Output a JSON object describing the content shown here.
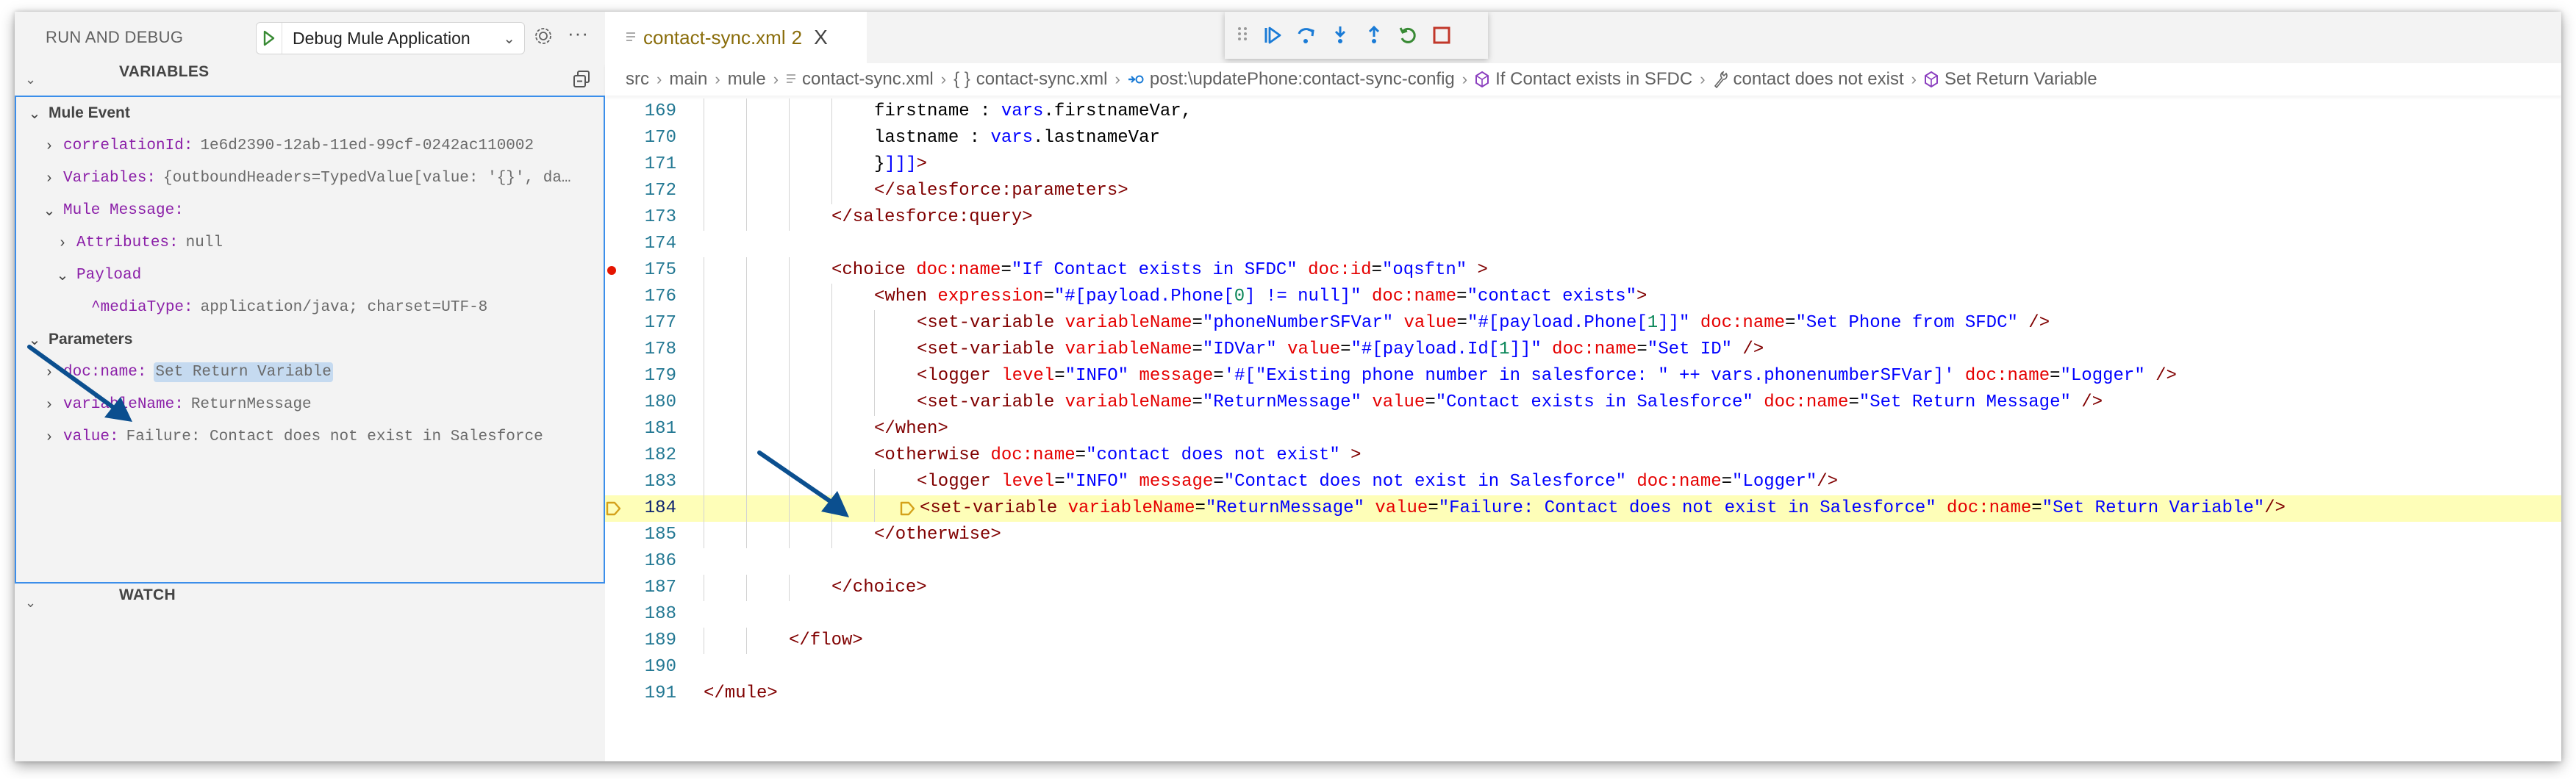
{
  "sidebar": {
    "title": "RUN AND DEBUG",
    "launch_config": "Debug Mule Application",
    "more_label": "···",
    "variables_header": "VARIABLES",
    "watch_header": "WATCH",
    "tree": [
      {
        "type": "group",
        "label": "Mule Event",
        "expanded": true
      },
      {
        "type": "item",
        "key": "correlationId:",
        "value": "1e6d2390-12ab-11ed-99cf-0242ac110002",
        "expanded": false
      },
      {
        "type": "item",
        "key": "Variables:",
        "value": "{outboundHeaders=TypedValue[value: '{}', da…",
        "expanded": false
      },
      {
        "type": "item",
        "key": "Mule Message:",
        "value": "",
        "expanded": true
      },
      {
        "type": "item",
        "key": "Attributes:",
        "value": "null",
        "expanded": false
      },
      {
        "type": "item",
        "key": "Payload",
        "value": "",
        "expanded": true
      },
      {
        "type": "leaf",
        "key": "^mediaType:",
        "value": "application/java; charset=UTF-8"
      },
      {
        "type": "group",
        "label": "Parameters",
        "expanded": true
      },
      {
        "type": "item",
        "key": "doc:name:",
        "value": "Set Return Variable",
        "expanded": false,
        "selected": true
      },
      {
        "type": "item",
        "key": "variableName:",
        "value": "ReturnMessage",
        "expanded": false
      },
      {
        "type": "item",
        "key": "value:",
        "value": "Failure: Contact does not exist in Salesforce",
        "expanded": false
      }
    ]
  },
  "editor": {
    "tab": {
      "name": "contact-sync.xml",
      "problems": "2",
      "close": "X"
    },
    "debug_toolbar": [
      "drag-handle",
      "continue",
      "step-over",
      "step-into",
      "step-out",
      "restart",
      "stop"
    ],
    "breadcrumb": [
      {
        "label": "src",
        "icon": ""
      },
      {
        "label": "main",
        "icon": ""
      },
      {
        "label": "mule",
        "icon": ""
      },
      {
        "label": "contact-sync.xml",
        "icon": "xml-file-icon"
      },
      {
        "label": "contact-sync.xml",
        "icon": "braces-icon"
      },
      {
        "label": "post:\\updatePhone:contact-sync-config",
        "icon": "flow-icon"
      },
      {
        "label": "If Contact exists in SFDC",
        "icon": "component-icon"
      },
      {
        "label": "contact does not exist",
        "icon": "wrench-icon"
      },
      {
        "label": "Set Return Variable",
        "icon": "component-icon"
      }
    ],
    "breakpoint_line": 175,
    "current_line": 184,
    "lines": [
      {
        "n": "169",
        "indent": 4,
        "tokens": [
          [
            "p",
            "firstname : "
          ],
          [
            "e",
            "vars"
          ],
          [
            "p",
            ".firstnameVar,"
          ]
        ]
      },
      {
        "n": "170",
        "indent": 4,
        "tokens": [
          [
            "p",
            "lastname : "
          ],
          [
            "e",
            "vars"
          ],
          [
            "p",
            ".lastnameVar"
          ]
        ]
      },
      {
        "n": "171",
        "indent": 4,
        "tokens": [
          [
            "p",
            "}"
          ],
          [
            "s",
            "]]]"
          ],
          [
            "t",
            ">"
          ]
        ]
      },
      {
        "n": "172",
        "indent": 4,
        "tokens": [
          [
            "t",
            "</salesforce:parameters>"
          ]
        ]
      },
      {
        "n": "173",
        "indent": 3,
        "tokens": [
          [
            "t",
            "</salesforce:query>"
          ]
        ]
      },
      {
        "n": "174",
        "indent": 0,
        "tokens": []
      },
      {
        "n": "175",
        "indent": 3,
        "tokens": [
          [
            "t",
            "<choice "
          ],
          [
            "a",
            "doc:name"
          ],
          [
            "p",
            "="
          ],
          [
            "s",
            "\"If Contact exists in SFDC\" "
          ],
          [
            "a",
            "doc:id"
          ],
          [
            "p",
            "="
          ],
          [
            "s",
            "\"oqsftn\""
          ],
          [
            "t",
            " >"
          ]
        ]
      },
      {
        "n": "176",
        "indent": 4,
        "tokens": [
          [
            "t",
            "<when "
          ],
          [
            "a",
            "expression"
          ],
          [
            "p",
            "="
          ],
          [
            "s",
            "\"#[payload.Phone["
          ],
          [
            "n",
            "0"
          ],
          [
            "s",
            "] != null]\" "
          ],
          [
            "a",
            "doc:name"
          ],
          [
            "p",
            "="
          ],
          [
            "s",
            "\"contact exists\""
          ],
          [
            "t",
            ">"
          ]
        ]
      },
      {
        "n": "177",
        "indent": 5,
        "tokens": [
          [
            "t",
            "<set-variable "
          ],
          [
            "a",
            "variableName"
          ],
          [
            "p",
            "="
          ],
          [
            "s",
            "\"phoneNumberSFVar\" "
          ],
          [
            "a",
            "value"
          ],
          [
            "p",
            "="
          ],
          [
            "s",
            "\"#[payload.Phone["
          ],
          [
            "n",
            "1"
          ],
          [
            "s",
            "]]\" "
          ],
          [
            "a",
            "doc:name"
          ],
          [
            "p",
            "="
          ],
          [
            "s",
            "\"Set Phone from SFDC\""
          ],
          [
            "t",
            " />"
          ]
        ]
      },
      {
        "n": "178",
        "indent": 5,
        "tokens": [
          [
            "t",
            "<set-variable "
          ],
          [
            "a",
            "variableName"
          ],
          [
            "p",
            "="
          ],
          [
            "s",
            "\"IDVar\" "
          ],
          [
            "a",
            "value"
          ],
          [
            "p",
            "="
          ],
          [
            "s",
            "\"#[payload.Id["
          ],
          [
            "n",
            "1"
          ],
          [
            "s",
            "]]\" "
          ],
          [
            "a",
            "doc:name"
          ],
          [
            "p",
            "="
          ],
          [
            "s",
            "\"Set ID\""
          ],
          [
            "t",
            " />"
          ]
        ]
      },
      {
        "n": "179",
        "indent": 5,
        "tokens": [
          [
            "t",
            "<logger "
          ],
          [
            "a",
            "level"
          ],
          [
            "p",
            "="
          ],
          [
            "s",
            "\"INFO\" "
          ],
          [
            "a",
            "message"
          ],
          [
            "p",
            "="
          ],
          [
            "s",
            "'#[\"Existing phone number in salesforce: \" ++ vars.phonenumberSFVar]' "
          ],
          [
            "a",
            "doc:name"
          ],
          [
            "p",
            "="
          ],
          [
            "s",
            "\"Logger\""
          ],
          [
            "t",
            " />"
          ]
        ]
      },
      {
        "n": "180",
        "indent": 5,
        "tokens": [
          [
            "t",
            "<set-variable "
          ],
          [
            "a",
            "variableName"
          ],
          [
            "p",
            "="
          ],
          [
            "s",
            "\"ReturnMessage\" "
          ],
          [
            "a",
            "value"
          ],
          [
            "p",
            "="
          ],
          [
            "s",
            "\"Contact exists in Salesforce\" "
          ],
          [
            "a",
            "doc:name"
          ],
          [
            "p",
            "="
          ],
          [
            "s",
            "\"Set Return Message\""
          ],
          [
            "t",
            " />"
          ]
        ]
      },
      {
        "n": "181",
        "indent": 4,
        "tokens": [
          [
            "t",
            "</when>"
          ]
        ]
      },
      {
        "n": "182",
        "indent": 4,
        "tokens": [
          [
            "t",
            "<otherwise "
          ],
          [
            "a",
            "doc:name"
          ],
          [
            "p",
            "="
          ],
          [
            "s",
            "\"contact does not exist\""
          ],
          [
            "t",
            " >"
          ]
        ]
      },
      {
        "n": "183",
        "indent": 5,
        "tokens": [
          [
            "t",
            "<logger "
          ],
          [
            "a",
            "level"
          ],
          [
            "p",
            "="
          ],
          [
            "s",
            "\"INFO\" "
          ],
          [
            "a",
            "message"
          ],
          [
            "p",
            "="
          ],
          [
            "s",
            "\"Contact does not exist in Salesforce\" "
          ],
          [
            "a",
            "doc:name"
          ],
          [
            "p",
            "="
          ],
          [
            "s",
            "\"Logger\""
          ],
          [
            "t",
            "/>"
          ]
        ]
      },
      {
        "n": "184",
        "indent": 5,
        "tokens": [
          [
            "t",
            "<set-variable "
          ],
          [
            "a",
            "variableName"
          ],
          [
            "p",
            "="
          ],
          [
            "s",
            "\"ReturnMessage\" "
          ],
          [
            "a",
            "value"
          ],
          [
            "p",
            "="
          ],
          [
            "s",
            "\"Failure: Contact does not exist in Salesforce\" "
          ],
          [
            "a",
            "doc:name"
          ],
          [
            "p",
            "="
          ],
          [
            "s",
            "\"Set Return Variable\""
          ],
          [
            "t",
            "/>"
          ]
        ]
      },
      {
        "n": "185",
        "indent": 4,
        "tokens": [
          [
            "t",
            "</otherwise>"
          ]
        ]
      },
      {
        "n": "186",
        "indent": 0,
        "tokens": []
      },
      {
        "n": "187",
        "indent": 3,
        "tokens": [
          [
            "t",
            "</choice>"
          ]
        ]
      },
      {
        "n": "188",
        "indent": 0,
        "tokens": []
      },
      {
        "n": "189",
        "indent": 2,
        "tokens": [
          [
            "t",
            "</flow>"
          ]
        ]
      },
      {
        "n": "190",
        "indent": 0,
        "tokens": []
      },
      {
        "n": "191",
        "indent": 0,
        "tokens": [
          [
            "t",
            "</mule>"
          ]
        ]
      }
    ]
  },
  "colors": {
    "accent": "#3b8eea",
    "breakpoint": "#e51400",
    "current_line_bg": "#fefeb8",
    "current_line_marker": "#d4a11a",
    "annotation_arrow": "#0b4f8f"
  }
}
